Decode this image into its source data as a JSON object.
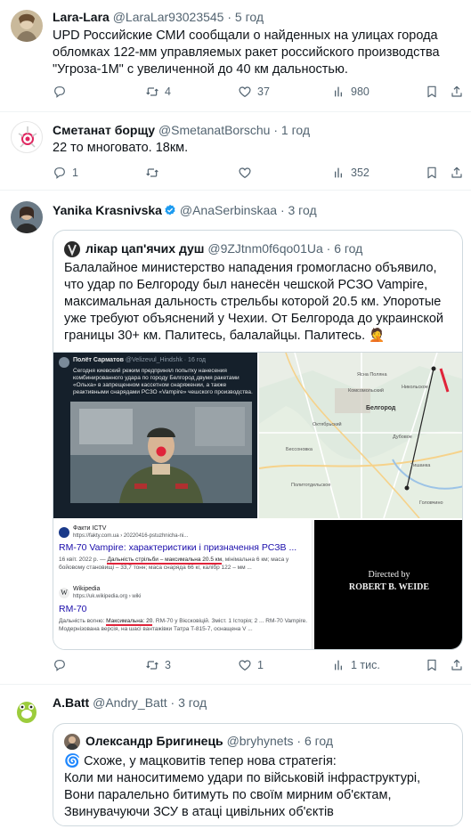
{
  "colors": {
    "text": "#0f1419",
    "secondary": "#536471",
    "link": "#1d9bf0",
    "border": "#eff3f4"
  },
  "tweets": [
    {
      "name": "Lara-Lara",
      "handle": "@LaraLar93023545",
      "sep": "·",
      "time": "5 год",
      "text": "UPD Российские СМИ сообщали о найденных на улицах города обломках 122-мм управляемых ракет российского производства \"Угроза-1М\" с увеличенной до 40 км дальностью.",
      "replies": "",
      "retweets": "4",
      "likes": "37",
      "views": "980"
    },
    {
      "name": "Сметанат борщу",
      "handle": "@SmetanatBorschu",
      "sep": "·",
      "time": "1 год",
      "text": "22 то многовато. 18км.",
      "replies": "1",
      "retweets": "",
      "likes": "",
      "views": "352"
    },
    {
      "name": "Yanika Krasnivska",
      "handle": "@AnaSerbinskaa",
      "sep": "·",
      "time": "3 год",
      "replies": "",
      "retweets": "3",
      "likes": "1",
      "views": "1 тис.",
      "quote": {
        "name": "лікар цап'ячих душ",
        "handle": "@9ZJtnm0f6qo01Ua",
        "sep": "·",
        "time": "6 год",
        "text": "Балалайное министерство нападения громогласно объявило, что удар по Белгороду был нанесён чешской РСЗО Vampire, максимальная дальность стрельбы которой 20.5 км. Упоротые уже требуют объяснений у Чехии. От Белгорода до украинской границы 30+ км. Палитесь, балалайцы. Палитесь. 🤦",
        "media": {
          "post": {
            "author": "Полёт Сарматов",
            "handle": "@Velizevul_Hindshk · 16 год",
            "text": "Сегодня киевский режим предпринял попытку нанесения комбинированного удара по городу Белгород двумя ракетами «Ольха» в запрещенном кассетном снаряжении, а также реактивными снарядами РСЗО «Vampire» чешского производства."
          },
          "map_labels": [
            "Ясна Поляна",
            "Комсомольский",
            "Белгород",
            "Бессоновка",
            "Дубовое",
            "Никольское",
            "Октябрьский",
            "Политотдельское",
            "Тишанка",
            "Головчино"
          ],
          "search": {
            "source1": "Факти ICTV",
            "url1": "https://fakty.com.ua › 20220416-pstuzhnicha-ni...",
            "title1": "RM-70 Vampire: характеристики і призначення РСЗВ ...",
            "snippet1_pre": "16 квіт. 2022 р. — ",
            "snippet1_hl": "Дальність стрільби – максимальна 20.5 км",
            "snippet1_post": ", мінімальна 6 км; маса у бойовому становищі – 33,7 тонн; маса снаряда 66 кг, калібр 122 – мм ...",
            "source2": "Wikipedia",
            "url2": "https://uk.wikipedia.org › wiki",
            "title2": "RM-70",
            "snippet2_pre": "Дальність вогню: ",
            "snippet2_hl": "Максимальна: 20",
            "snippet2_post": ". RM-70 у Вієсковіцій. Зміст. 1 Історія; 2 ... RM-70 Vampire. Модернізована версія, на шасі вантажівки Татра T-815-7, оснащена V ..."
          },
          "credits": {
            "line1": "Directed by",
            "line2": "ROBERT B. WEIDE"
          }
        }
      }
    },
    {
      "name": "A.Batt",
      "handle": "@Andry_Batt",
      "sep": "·",
      "time": "3 год",
      "quote": {
        "name": "Олександр Бригинець",
        "handle": "@bryhynets",
        "sep": "·",
        "time": "6 год",
        "text": "🌀 Схоже, у мацковитів тепер нова стратегія:\nКоли ми наноситимемо удари по військовій інфраструктурі,\nВони паралельно битимуть по своїм мирним об'єктам,\nЗвинувачуючи ЗСУ в атаці цивільних об'єктів"
      }
    }
  ]
}
